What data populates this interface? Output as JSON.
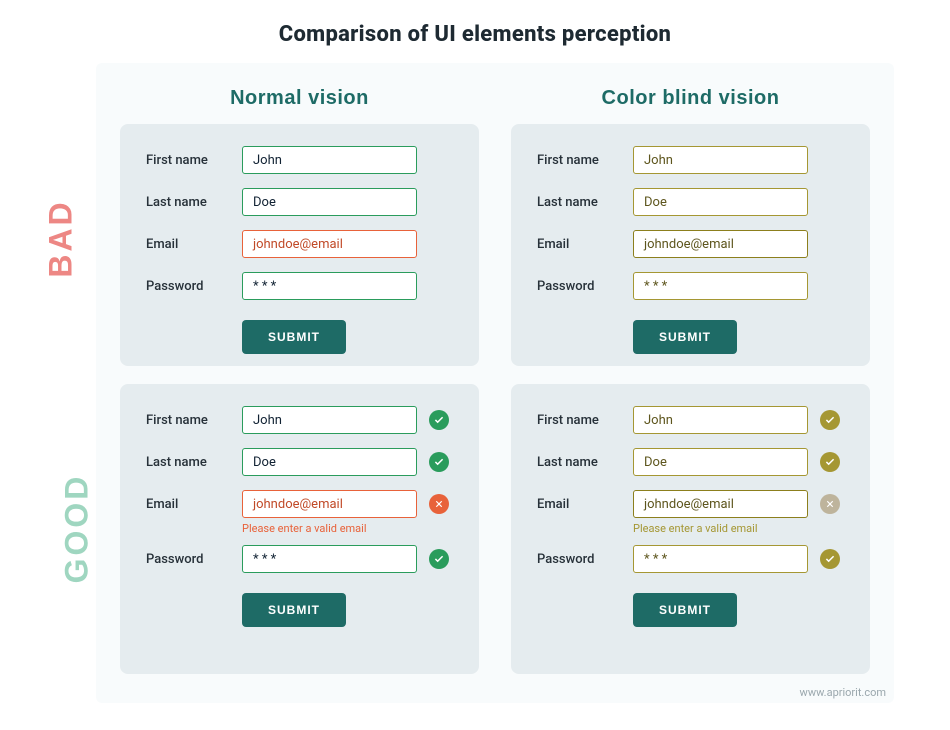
{
  "title": "Comparison of UI elements perception",
  "side": {
    "bad": "BAD",
    "good": "GOOD"
  },
  "columns": {
    "normal": "Normal vision",
    "colorblind": "Color blind vision"
  },
  "labels": {
    "firstname": "First name",
    "lastname": "Last name",
    "email": "Email",
    "password": "Password"
  },
  "values": {
    "firstname": "John",
    "lastname": "Doe",
    "email": "johndoe@email",
    "password": "* * *"
  },
  "hint": "Please enter a valid email",
  "submit": "SUBMIT",
  "footer": "www.apriorit.com"
}
